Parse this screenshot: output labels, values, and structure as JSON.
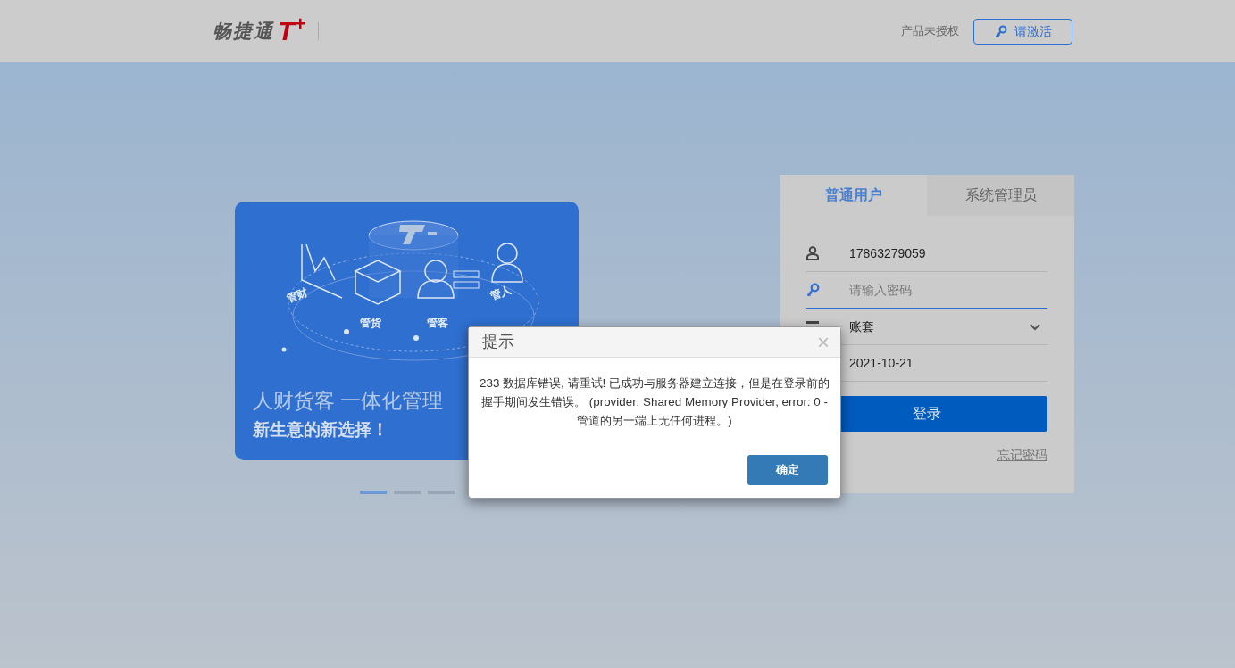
{
  "header": {
    "logo": {
      "name": "畅捷通",
      "mark": "T$^{+}$"
    },
    "license_status": "产品未授权",
    "activate_button": "请激活"
  },
  "banner": {
    "illustration_labels": [
      "管财",
      "管货",
      "管客",
      "管人"
    ],
    "headline": "人财货客 一体化管理",
    "subline": "新生意的新选择！"
  },
  "carousel_indicators": [
    {
      "selected": true
    },
    {
      "selected": false
    },
    {
      "selected": false
    }
  ],
  "login": {
    "tabs": [
      {
        "label": "普通用户",
        "selected": true
      },
      {
        "label": "系统管理员",
        "selected": false
      }
    ],
    "fields": [
      {
        "kind": "text",
        "value": "17863279059",
        "focused": false
      },
      {
        "kind": "password",
        "placeholder": "请输入密码",
        "focused": true
      },
      {
        "kind": "select",
        "value": "账套",
        "focused": false
      },
      {
        "kind": "date",
        "value": "2021-10-21",
        "focused": false
      }
    ],
    "login_button": "登录",
    "forgot_link": "忘记密码"
  },
  "dialog": {
    "title": "提示",
    "message": "233 数据库错误, 请重试! 已成功与服务器建立连接，但是在登录前的握手期间发生错误。 (provider: Shared Memory Provider, error: 0 - 管道的另一端上无任何进程。)",
    "close": "×",
    "ok_button": "确定"
  }
}
